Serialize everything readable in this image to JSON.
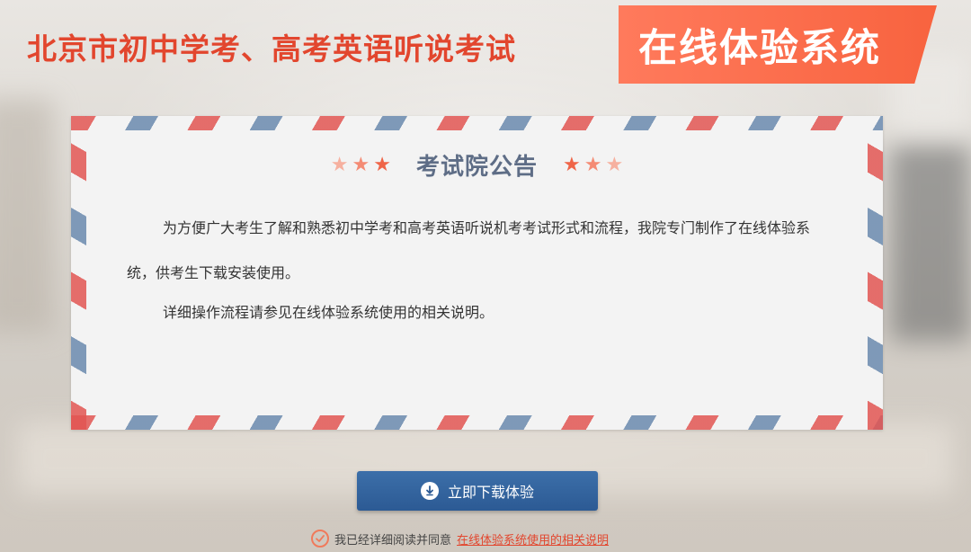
{
  "header": {
    "title": "北京市初中学考、高考英语听说考试",
    "badge": "在线体验系统"
  },
  "notice": {
    "title": "考试院公告",
    "paragraph1": "为方便广大考生了解和熟悉初中学考和高考英语听说机考考试形式和流程，我院专门制作了在线体验系统，供考生下载安装使用。",
    "paragraph2": "详细操作流程请参见在线体验系统使用的相关说明。"
  },
  "download": {
    "label": "立即下载体验",
    "icon": "download-circle-icon"
  },
  "agreement": {
    "text": "我已经详细阅读并同意",
    "link": "在线体验系统使用的相关说明",
    "checked": true
  },
  "colors": {
    "title_red": "#e2462e",
    "badge_orange": "#f8633f",
    "notice_title": "#5e6d86",
    "button_blue": "#2c5a94",
    "stripe_red": "#e25552",
    "stripe_blue": "#6a89ad"
  }
}
